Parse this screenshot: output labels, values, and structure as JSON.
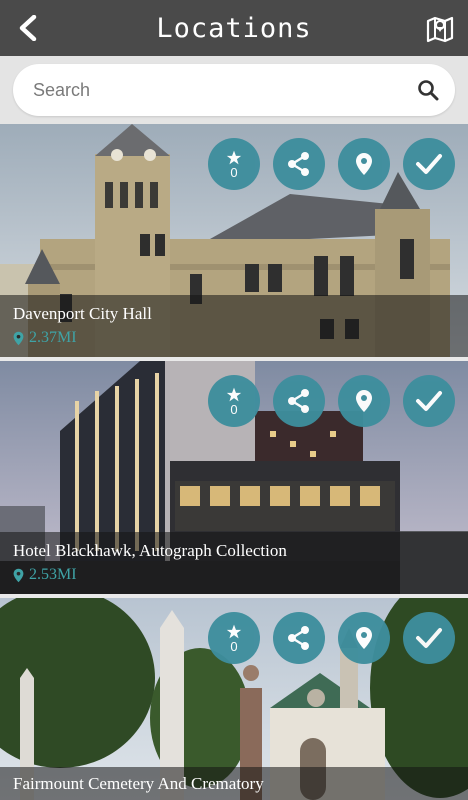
{
  "header": {
    "title": "Locations",
    "back_icon": "chevron-left-icon",
    "map_icon": "map-marker-icon"
  },
  "search": {
    "placeholder": "Search",
    "icon": "search-icon"
  },
  "colors": {
    "header_bg": "#4a4a4a",
    "accent": "#3e8e9d",
    "distance": "#3fa3a6"
  },
  "locations": [
    {
      "name": "Davenport City Hall",
      "distance": "2.37MI",
      "star_count": "0"
    },
    {
      "name": "Hotel Blackhawk, Autograph Collection",
      "distance": "2.53MI",
      "star_count": "0"
    },
    {
      "name": "Fairmount Cemetery And Crematory",
      "distance": "",
      "star_count": "0"
    }
  ],
  "action_icons": [
    "star-icon",
    "share-icon",
    "location-pin-icon",
    "checkmark-icon"
  ]
}
